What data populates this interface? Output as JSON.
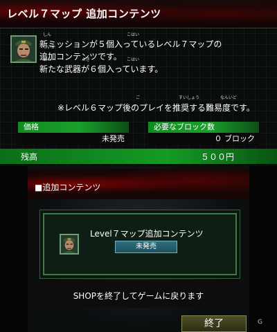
{
  "top_screen": {
    "title": "レベル７マップ 追加コンテンツ",
    "description_lines": [
      "新ミッションが５個入っているレベル７マップの",
      "追加コンテンツです。",
      "新たな武器が６個入っています。",
      "",
      "※レベル６マップ後のプレイを推奨する難易度です。"
    ],
    "ruby": {
      "shin": "しん",
      "kohai": "こはい",
      "tsuika": "ついか",
      "arata": "あら",
      "buki": "ぶき",
      "kohai2": "こはい",
      "go": "ご",
      "suishou": "すいしょう",
      "nanido": "なんいど"
    },
    "price_label": "価格",
    "price_value": "未発売",
    "blocks_label": "必要なブロック数",
    "blocks_value": "０ ブロック",
    "balance_label": "残高",
    "balance_value": "５００円"
  },
  "bottom_screen": {
    "section_title": "■追加コンテンツ",
    "item_title": "Level７マップ追加コンテンツ",
    "item_status": "未発売",
    "exit_message": "SHOPを終了してゲームに戻ります",
    "end_button_label": "終了",
    "watermark": "G"
  }
}
